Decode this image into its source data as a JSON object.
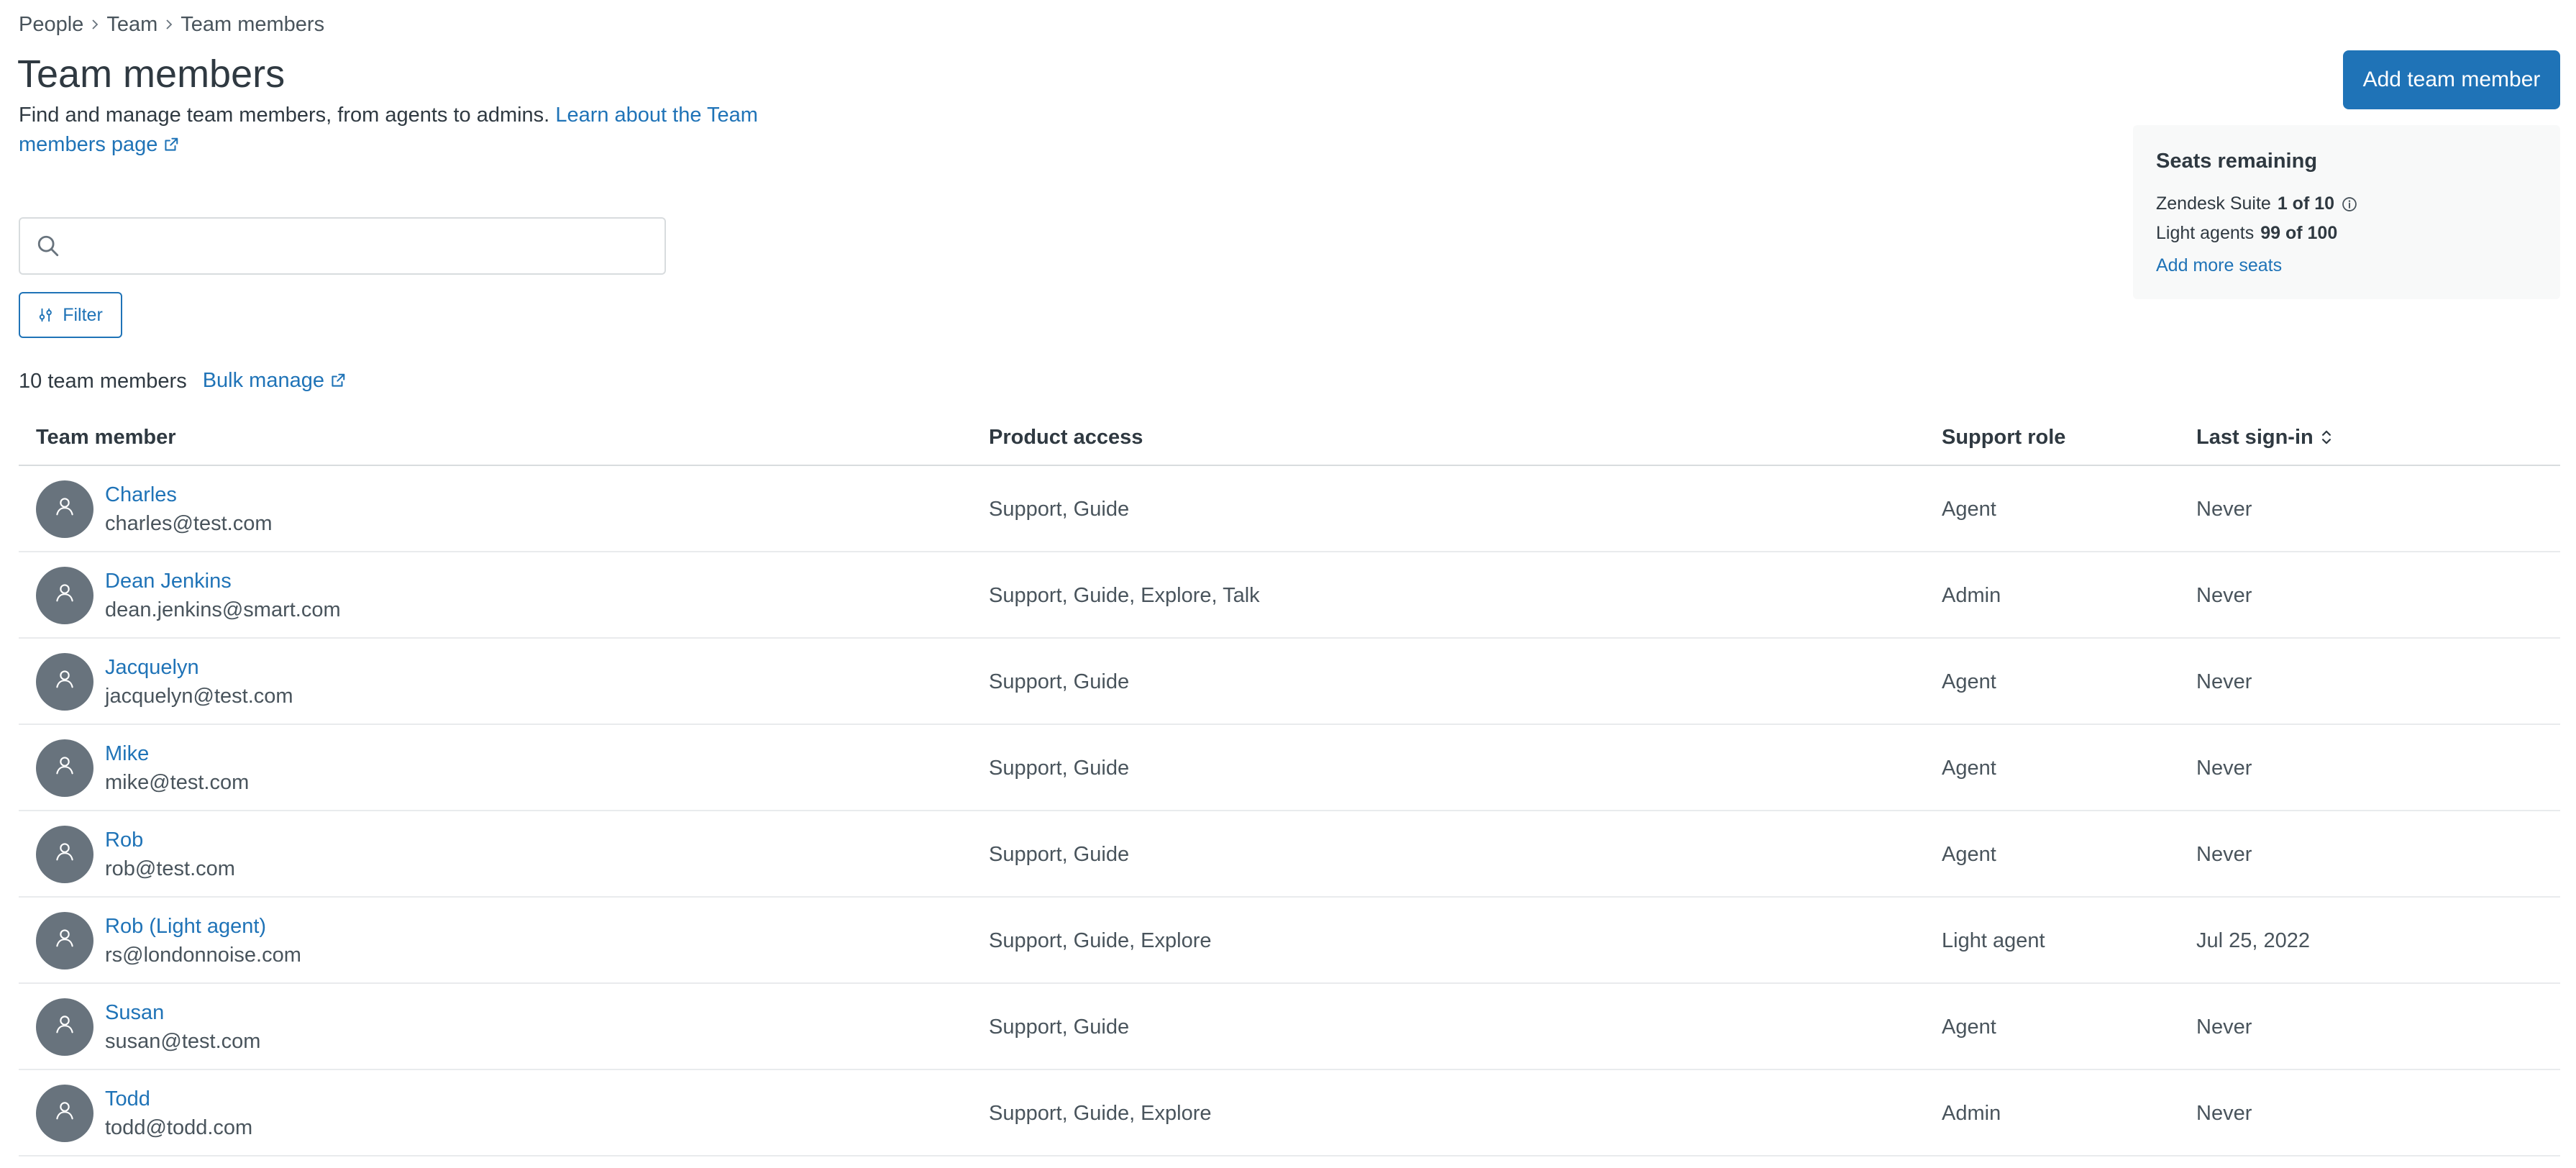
{
  "breadcrumb": {
    "items": [
      "People",
      "Team",
      "Team members"
    ]
  },
  "header": {
    "title": "Team members",
    "description": "Find and manage team members, from agents to admins.",
    "learn_link": "Learn about the Team members page",
    "add_button": "Add team member"
  },
  "seats": {
    "title": "Seats remaining",
    "suite_label": "Zendesk Suite",
    "suite_value": "1 of 10",
    "light_label": "Light agents",
    "light_value": "99 of 100",
    "add_more": "Add more seats"
  },
  "search": {
    "placeholder": "",
    "value": ""
  },
  "filter": {
    "label": "Filter"
  },
  "summary": {
    "count": "10 team members",
    "bulk_manage": "Bulk manage"
  },
  "table": {
    "columns": {
      "member": "Team member",
      "product": "Product access",
      "role": "Support role",
      "signin": "Last sign-in"
    },
    "rows": [
      {
        "name": "Charles",
        "email": "charles@test.com",
        "product": "Support, Guide",
        "role": "Agent",
        "signin": "Never"
      },
      {
        "name": "Dean Jenkins",
        "email": "dean.jenkins@smart.com",
        "product": "Support, Guide, Explore, Talk",
        "role": "Admin",
        "signin": "Never"
      },
      {
        "name": "Jacquelyn",
        "email": "jacquelyn@test.com",
        "product": "Support, Guide",
        "role": "Agent",
        "signin": "Never"
      },
      {
        "name": "Mike",
        "email": "mike@test.com",
        "product": "Support, Guide",
        "role": "Agent",
        "signin": "Never"
      },
      {
        "name": "Rob",
        "email": "rob@test.com",
        "product": "Support, Guide",
        "role": "Agent",
        "signin": "Never"
      },
      {
        "name": "Rob (Light agent)",
        "email": "rs@londonnoise.com",
        "product": "Support, Guide, Explore",
        "role": "Light agent",
        "signin": "Jul 25, 2022"
      },
      {
        "name": "Susan",
        "email": "susan@test.com",
        "product": "Support, Guide",
        "role": "Agent",
        "signin": "Never"
      },
      {
        "name": "Todd",
        "email": "todd@todd.com",
        "product": "Support, Guide, Explore",
        "role": "Admin",
        "signin": "Never"
      }
    ]
  },
  "icons": {
    "chevron_right": "chevron-right-icon",
    "external_link": "external-link-icon",
    "info": "info-icon",
    "search": "search-icon",
    "filter": "filter-icon",
    "sort": "sort-icon",
    "avatar_user": "user-icon"
  },
  "colors": {
    "accent": "#1f73b7",
    "text": "#2f3941",
    "muted_text": "#49545c",
    "avatar_bg": "#68737d",
    "panel_bg": "#f8f9f9",
    "border": "#d8dcde"
  }
}
